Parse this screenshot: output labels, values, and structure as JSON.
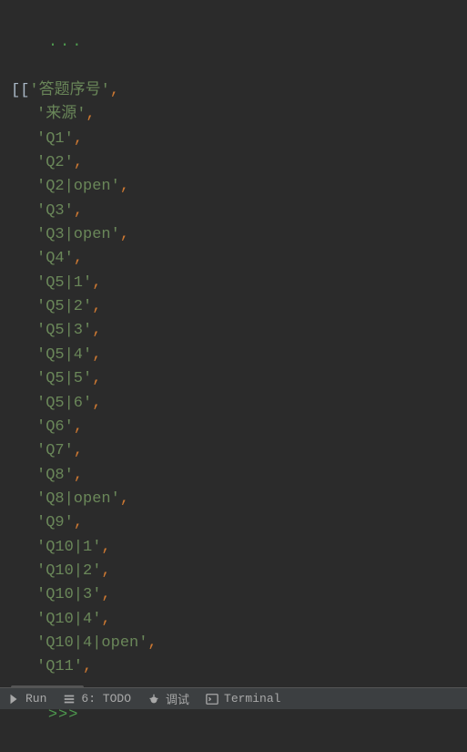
{
  "console": {
    "continuation_prompt": "...",
    "ready_prompt": ">>>",
    "open_brackets": "[[",
    "items": [
      "答题序号",
      "来源",
      "Q1",
      "Q2",
      "Q2|open",
      "Q3",
      "Q3|open",
      "Q4",
      "Q5|1",
      "Q5|2",
      "Q5|3",
      "Q5|4",
      "Q5|5",
      "Q5|6",
      "Q6",
      "Q7",
      "Q8",
      "Q8|open",
      "Q9",
      "Q10|1",
      "Q10|2",
      "Q10|3",
      "Q10|4",
      "Q10|4|open",
      "Q11"
    ]
  },
  "bottom_bar": {
    "run": "Run",
    "todo": "6: TODO",
    "debug": "调试",
    "terminal": "Terminal"
  }
}
